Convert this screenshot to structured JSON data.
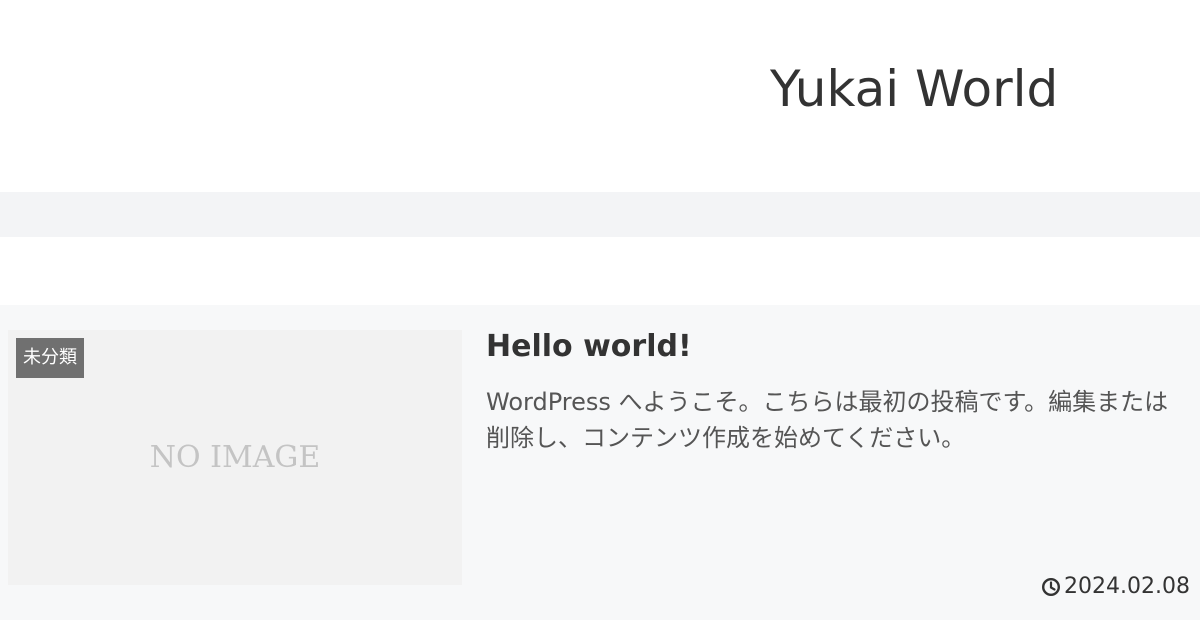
{
  "header": {
    "site_title": "Yukai World"
  },
  "post": {
    "category": "未分類",
    "thumbnail_placeholder": "NO IMAGE",
    "title": "Hello world!",
    "excerpt": "WordPress へようこそ。こちらは最初の投稿です。編集または削除し、コンテンツ作成を始めてください。",
    "date": "2024.02.08",
    "date_icon": "clock-icon"
  },
  "colors": {
    "nav_band": "#f3f4f6",
    "card_background": "#f7f8f9",
    "thumbnail_background": "#f2f2f2",
    "category_badge": "#707070"
  }
}
